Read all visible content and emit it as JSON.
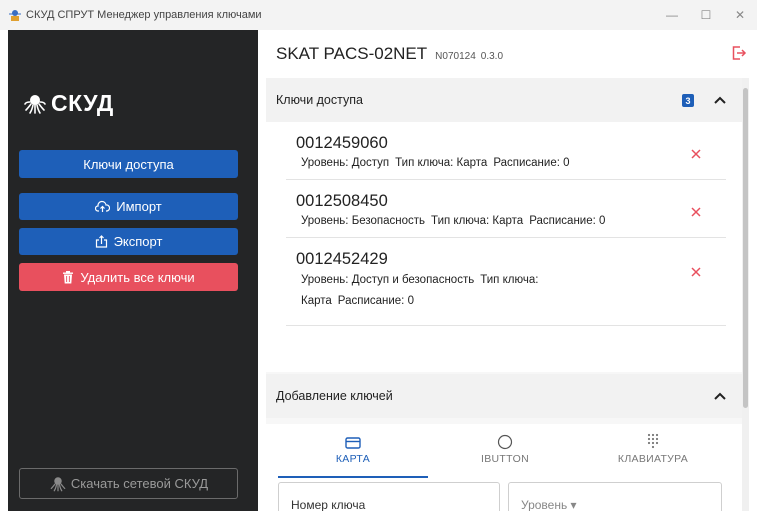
{
  "window": {
    "title": "СКУД СПРУТ Менеджер управления ключами",
    "minimize": "—",
    "maximize": "☐",
    "close": "✕"
  },
  "sidebar": {
    "brand": "СКУД",
    "buttons": {
      "keys": "Ключи доступа",
      "import": "Импорт",
      "export": "Экспорт",
      "delete_all": "Удалить все ключи",
      "download": "Скачать сетевой СКУД"
    }
  },
  "header": {
    "device_name": "SKAT PACS-02NET",
    "serial": "N070124",
    "version": "0.3.0"
  },
  "keys_section": {
    "title": "Ключи доступа",
    "count": "3",
    "items": [
      {
        "number": "0012459060",
        "level": "Уровень: Доступ",
        "key_type": "Тип ключа: Карта",
        "schedule": "Расписание: 0"
      },
      {
        "number": "0012508450",
        "level": "Уровень: Безопасность",
        "key_type": "Тип ключа: Карта",
        "schedule": "Расписание: 0"
      },
      {
        "number": "0012452429",
        "level": "Уровень: Доступ и безопасность",
        "key_type": "Тип ключа: Карта",
        "schedule": "Расписание: 0"
      }
    ]
  },
  "add_section": {
    "title": "Добавление ключей",
    "tabs": [
      "КАРТА",
      "IBUTTON",
      "КЛАВИАТУРА"
    ],
    "active_tab": 0,
    "key_number_placeholder": "Номер ключа",
    "level_placeholder": "Уровень ▾"
  },
  "colors": {
    "accent": "#1e5fb8",
    "danger": "#e8505e",
    "sidebar_bg": "#242526"
  }
}
